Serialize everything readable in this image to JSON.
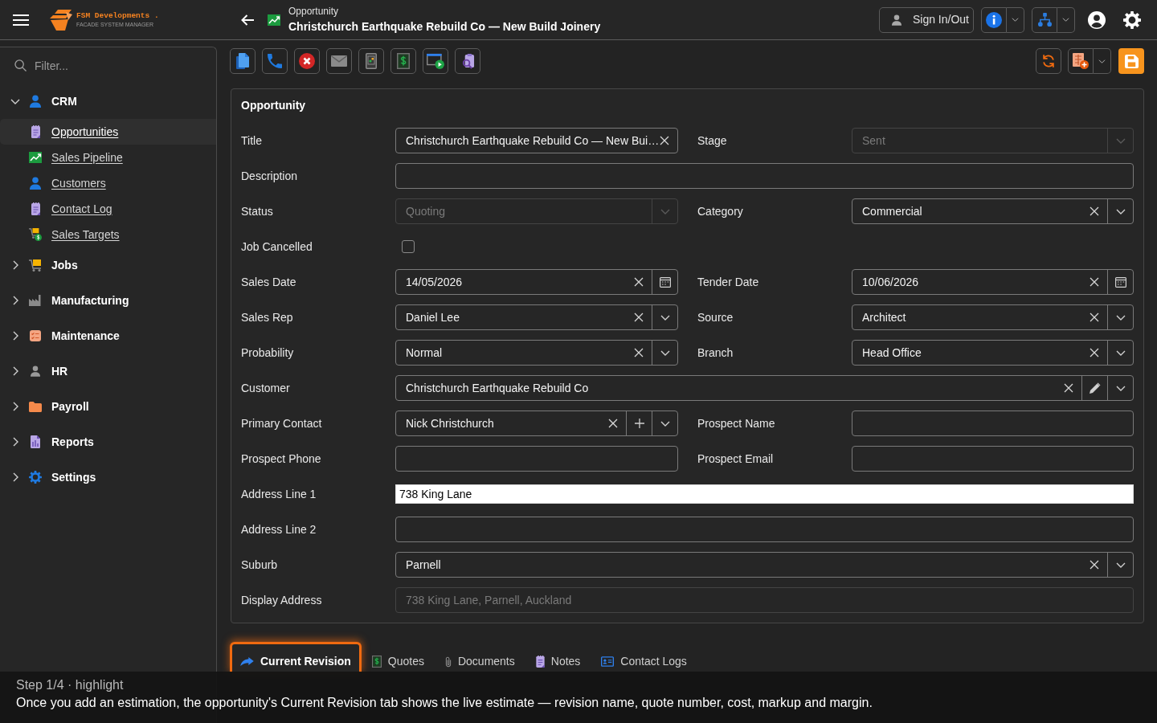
{
  "header": {
    "logo": {
      "name": "FSM Developments .",
      "tagline": "FACADE SYSTEM MANAGER"
    },
    "breadcrumb": "Opportunity",
    "title": "Christchurch Earthquake Rebuild Co — New Build Joinery",
    "sign_in_button": "Sign In/Out"
  },
  "sidebar": {
    "filter": {
      "placeholder": "Filter..."
    },
    "items": [
      {
        "label": "CRM",
        "expanded": true,
        "children": [
          {
            "label": "Opportunities",
            "selected": true
          },
          {
            "label": "Sales Pipeline",
            "selected": false
          },
          {
            "label": "Customers",
            "selected": false
          },
          {
            "label": "Contact Log",
            "selected": false
          },
          {
            "label": "Sales Targets",
            "selected": false
          }
        ]
      },
      {
        "label": "Jobs",
        "expanded": false
      },
      {
        "label": "Manufacturing",
        "expanded": false
      },
      {
        "label": "Maintenance",
        "expanded": false
      },
      {
        "label": "HR",
        "expanded": false
      },
      {
        "label": "Payroll",
        "expanded": false
      },
      {
        "label": "Reports",
        "expanded": false
      },
      {
        "label": "Settings",
        "expanded": false
      }
    ]
  },
  "form": {
    "title": "Opportunity",
    "rows": [
      {
        "fields": [
          {
            "label": "Title",
            "kind": "text",
            "value": "Christchurch Earthquake Rebuild Co — New Bui…",
            "disabled": false,
            "focused": false
          },
          {
            "label": "Stage",
            "kind": "select",
            "value": "Sent",
            "disabled": true
          }
        ]
      },
      {
        "fields": [
          {
            "label": "Description",
            "kind": "text",
            "disabled": false,
            "focused": false
          }
        ]
      },
      {
        "fields": [
          {
            "label": "Status",
            "kind": "select",
            "value": "Quoting",
            "disabled": true
          },
          {
            "label": "Category",
            "kind": "select",
            "value": "Commercial",
            "disabled": false
          }
        ]
      },
      {
        "fields": [
          {
            "label": "Job Cancelled",
            "kind": "checkbox",
            "checked": false,
            "disabled": false
          }
        ]
      },
      {
        "fields": [
          {
            "label": "Sales Date",
            "kind": "date",
            "value": "14/05/2026",
            "disabled": false
          },
          {
            "label": "Tender Date",
            "kind": "date",
            "value": "10/06/2026",
            "disabled": false
          }
        ]
      },
      {
        "fields": [
          {
            "label": "Sales Rep",
            "kind": "select",
            "value": "Daniel Lee",
            "disabled": false
          },
          {
            "label": "Source",
            "kind": "select",
            "value": "Architect",
            "disabled": false
          }
        ]
      },
      {
        "fields": [
          {
            "label": "Probability",
            "kind": "select",
            "value": "Normal",
            "disabled": false
          },
          {
            "label": "Branch",
            "kind": "select",
            "value": "Head Office",
            "disabled": false
          }
        ]
      },
      {
        "fields": [
          {
            "label": "Customer",
            "kind": "select_edit",
            "value": "Christchurch Earthquake Rebuild Co",
            "disabled": false
          }
        ]
      },
      {
        "fields": [
          {
            "label": "Primary Contact",
            "kind": "select_add",
            "value": "Nick Christchurch",
            "disabled": false
          },
          {
            "label": "Prospect Name",
            "kind": "text",
            "disabled": false,
            "focused": false
          }
        ]
      },
      {
        "fields": [
          {
            "label": "Prospect Phone",
            "kind": "text",
            "disabled": false,
            "focused": false
          },
          {
            "label": "Prospect Email",
            "kind": "text",
            "disabled": false,
            "focused": false
          }
        ]
      },
      {
        "fields": [
          {
            "label": "Address Line 1",
            "kind": "text",
            "value": "738 King Lane",
            "disabled": false,
            "focused": true
          }
        ]
      },
      {
        "fields": [
          {
            "label": "Address Line 2",
            "kind": "text",
            "disabled": false,
            "focused": false
          }
        ]
      },
      {
        "fields": [
          {
            "label": "Suburb",
            "kind": "select",
            "value": "Parnell",
            "disabled": false
          }
        ]
      },
      {
        "fields": [
          {
            "label": "Display Address",
            "kind": "text",
            "value": "738 King Lane, Parnell, Auckland",
            "disabled": true,
            "focused": false
          }
        ]
      }
    ]
  },
  "tabs": [
    {
      "label": "Current Revision",
      "selected": true,
      "highlighted": true
    },
    {
      "label": "Quotes",
      "selected": false,
      "highlighted": false
    },
    {
      "label": "Documents",
      "selected": false,
      "highlighted": false
    },
    {
      "label": "Notes",
      "selected": false,
      "highlighted": false
    },
    {
      "label": "Contact Logs",
      "selected": false,
      "highlighted": false
    }
  ],
  "tour": {
    "step": "Step 1/4 · highlight",
    "message": "Once you add an estimation, the opportunity's Current Revision tab shows the live estimate — revision name, quote number, cost, markup and margin."
  }
}
